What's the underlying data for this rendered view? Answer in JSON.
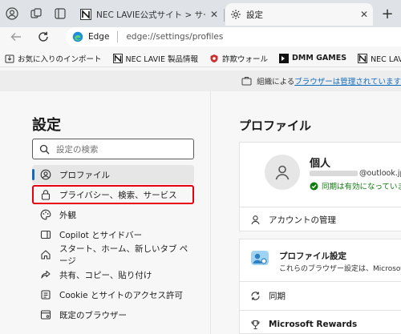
{
  "tabs": [
    {
      "title": "NEC LAVIE公式サイト > サービス＆サ",
      "active": false
    },
    {
      "title": "設定",
      "active": true
    }
  ],
  "icons": {
    "profile": "profile-icon",
    "workspaces": "workspaces-icon",
    "tab_actions": "tab-actions-icon",
    "new_tab": "plus-icon"
  },
  "toolbar": {
    "brand": "Edge",
    "url": "edge://settings/profiles"
  },
  "favorites": [
    {
      "label": "お気に入りのインポート",
      "icon": "import-icon"
    },
    {
      "label": "NEC LAVIE 製品情報",
      "icon": "nec-icon"
    },
    {
      "label": "詐欺ウォール",
      "icon": "shield-icon"
    },
    {
      "label": "DMM GAMES",
      "icon": "dmm-icon"
    },
    {
      "label": "NEC LAVIE 公式サイト",
      "icon": "nec-icon"
    }
  ],
  "managed": {
    "prefix": "組織による",
    "link": "ブラウザーは管理されています"
  },
  "sidebar": {
    "title": "設定",
    "search_placeholder": "設定の検索",
    "items": [
      {
        "label": "プロファイル",
        "icon": "profile-icon",
        "selected": true
      },
      {
        "label": "プライバシー、検索、サービス",
        "icon": "lock-icon",
        "selected": false
      },
      {
        "label": "外観",
        "icon": "appearance-icon",
        "selected": false
      },
      {
        "label": "Copilot とサイドバー",
        "icon": "sidebar-icon",
        "selected": false
      },
      {
        "label": "スタート、ホーム、新しいタブ ページ",
        "icon": "home-icon",
        "selected": false
      },
      {
        "label": "共有、コピー、貼り付け",
        "icon": "share-icon",
        "selected": false
      },
      {
        "label": "Cookie とサイトのアクセス許可",
        "icon": "cookie-icon",
        "selected": false
      },
      {
        "label": "既定のブラウザー",
        "icon": "browser-icon",
        "selected": false
      }
    ]
  },
  "main": {
    "title": "プロファイル",
    "profile": {
      "name": "個人",
      "email_suffix": "@outlook.jp",
      "sync_status": "同期は有効になっています",
      "sync_color": "#107c10"
    },
    "account_manage": "アカウントの管理",
    "profile_settings": {
      "title": "プロファイル設定",
      "desc": "これらのブラウザー設定は、Microsoft Ed"
    },
    "sync": "同期",
    "rewards": "Microsoft Rewards"
  },
  "colors": {
    "accent": "#0f6cbd",
    "highlight_box": "#e60012"
  }
}
